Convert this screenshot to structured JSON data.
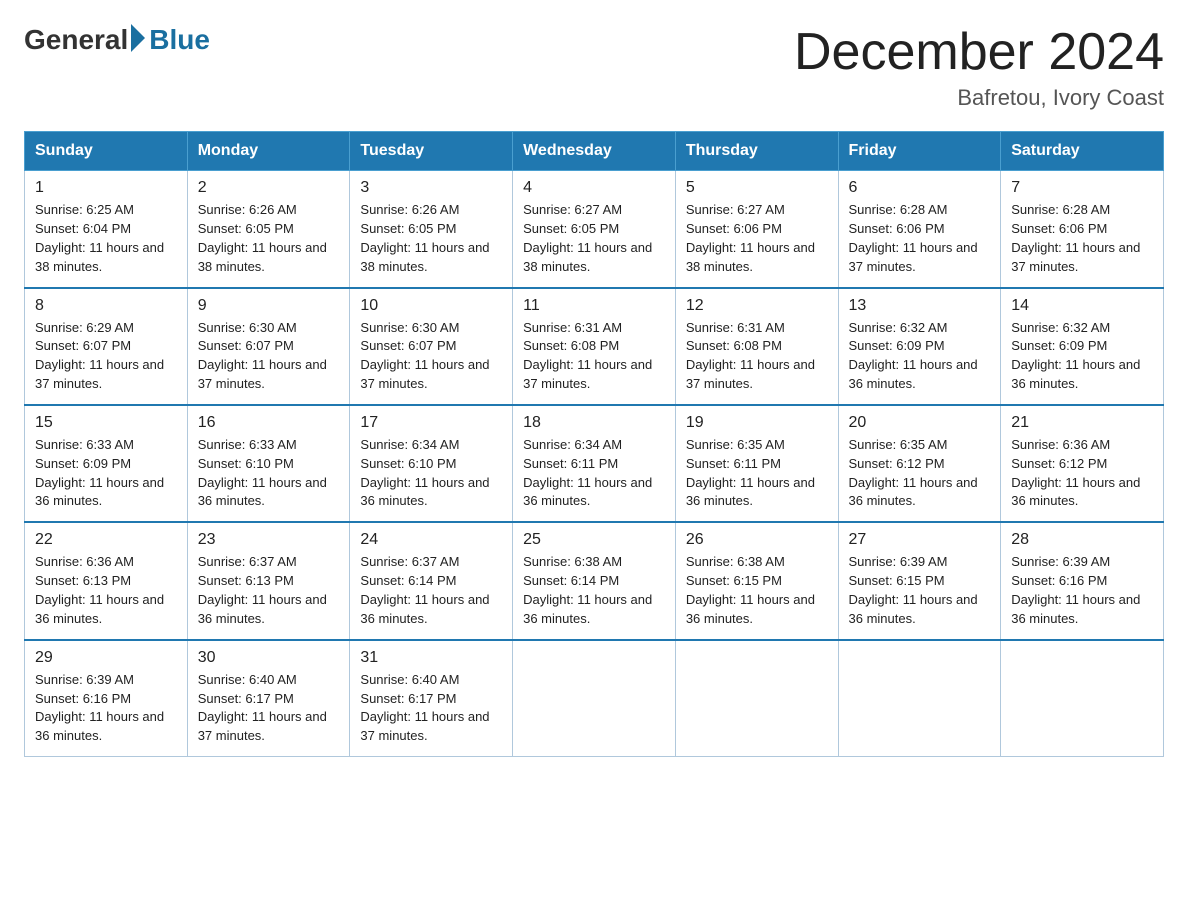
{
  "logo": {
    "general": "General",
    "blue": "Blue"
  },
  "title": "December 2024",
  "subtitle": "Bafretou, Ivory Coast",
  "weekdays": [
    "Sunday",
    "Monday",
    "Tuesday",
    "Wednesday",
    "Thursday",
    "Friday",
    "Saturday"
  ],
  "weeks": [
    [
      {
        "day": "1",
        "sunrise": "6:25 AM",
        "sunset": "6:04 PM",
        "daylight": "11 hours and 38 minutes."
      },
      {
        "day": "2",
        "sunrise": "6:26 AM",
        "sunset": "6:05 PM",
        "daylight": "11 hours and 38 minutes."
      },
      {
        "day": "3",
        "sunrise": "6:26 AM",
        "sunset": "6:05 PM",
        "daylight": "11 hours and 38 minutes."
      },
      {
        "day": "4",
        "sunrise": "6:27 AM",
        "sunset": "6:05 PM",
        "daylight": "11 hours and 38 minutes."
      },
      {
        "day": "5",
        "sunrise": "6:27 AM",
        "sunset": "6:06 PM",
        "daylight": "11 hours and 38 minutes."
      },
      {
        "day": "6",
        "sunrise": "6:28 AM",
        "sunset": "6:06 PM",
        "daylight": "11 hours and 37 minutes."
      },
      {
        "day": "7",
        "sunrise": "6:28 AM",
        "sunset": "6:06 PM",
        "daylight": "11 hours and 37 minutes."
      }
    ],
    [
      {
        "day": "8",
        "sunrise": "6:29 AM",
        "sunset": "6:07 PM",
        "daylight": "11 hours and 37 minutes."
      },
      {
        "day": "9",
        "sunrise": "6:30 AM",
        "sunset": "6:07 PM",
        "daylight": "11 hours and 37 minutes."
      },
      {
        "day": "10",
        "sunrise": "6:30 AM",
        "sunset": "6:07 PM",
        "daylight": "11 hours and 37 minutes."
      },
      {
        "day": "11",
        "sunrise": "6:31 AM",
        "sunset": "6:08 PM",
        "daylight": "11 hours and 37 minutes."
      },
      {
        "day": "12",
        "sunrise": "6:31 AM",
        "sunset": "6:08 PM",
        "daylight": "11 hours and 37 minutes."
      },
      {
        "day": "13",
        "sunrise": "6:32 AM",
        "sunset": "6:09 PM",
        "daylight": "11 hours and 36 minutes."
      },
      {
        "day": "14",
        "sunrise": "6:32 AM",
        "sunset": "6:09 PM",
        "daylight": "11 hours and 36 minutes."
      }
    ],
    [
      {
        "day": "15",
        "sunrise": "6:33 AM",
        "sunset": "6:09 PM",
        "daylight": "11 hours and 36 minutes."
      },
      {
        "day": "16",
        "sunrise": "6:33 AM",
        "sunset": "6:10 PM",
        "daylight": "11 hours and 36 minutes."
      },
      {
        "day": "17",
        "sunrise": "6:34 AM",
        "sunset": "6:10 PM",
        "daylight": "11 hours and 36 minutes."
      },
      {
        "day": "18",
        "sunrise": "6:34 AM",
        "sunset": "6:11 PM",
        "daylight": "11 hours and 36 minutes."
      },
      {
        "day": "19",
        "sunrise": "6:35 AM",
        "sunset": "6:11 PM",
        "daylight": "11 hours and 36 minutes."
      },
      {
        "day": "20",
        "sunrise": "6:35 AM",
        "sunset": "6:12 PM",
        "daylight": "11 hours and 36 minutes."
      },
      {
        "day": "21",
        "sunrise": "6:36 AM",
        "sunset": "6:12 PM",
        "daylight": "11 hours and 36 minutes."
      }
    ],
    [
      {
        "day": "22",
        "sunrise": "6:36 AM",
        "sunset": "6:13 PM",
        "daylight": "11 hours and 36 minutes."
      },
      {
        "day": "23",
        "sunrise": "6:37 AM",
        "sunset": "6:13 PM",
        "daylight": "11 hours and 36 minutes."
      },
      {
        "day": "24",
        "sunrise": "6:37 AM",
        "sunset": "6:14 PM",
        "daylight": "11 hours and 36 minutes."
      },
      {
        "day": "25",
        "sunrise": "6:38 AM",
        "sunset": "6:14 PM",
        "daylight": "11 hours and 36 minutes."
      },
      {
        "day": "26",
        "sunrise": "6:38 AM",
        "sunset": "6:15 PM",
        "daylight": "11 hours and 36 minutes."
      },
      {
        "day": "27",
        "sunrise": "6:39 AM",
        "sunset": "6:15 PM",
        "daylight": "11 hours and 36 minutes."
      },
      {
        "day": "28",
        "sunrise": "6:39 AM",
        "sunset": "6:16 PM",
        "daylight": "11 hours and 36 minutes."
      }
    ],
    [
      {
        "day": "29",
        "sunrise": "6:39 AM",
        "sunset": "6:16 PM",
        "daylight": "11 hours and 36 minutes."
      },
      {
        "day": "30",
        "sunrise": "6:40 AM",
        "sunset": "6:17 PM",
        "daylight": "11 hours and 37 minutes."
      },
      {
        "day": "31",
        "sunrise": "6:40 AM",
        "sunset": "6:17 PM",
        "daylight": "11 hours and 37 minutes."
      },
      null,
      null,
      null,
      null
    ]
  ]
}
